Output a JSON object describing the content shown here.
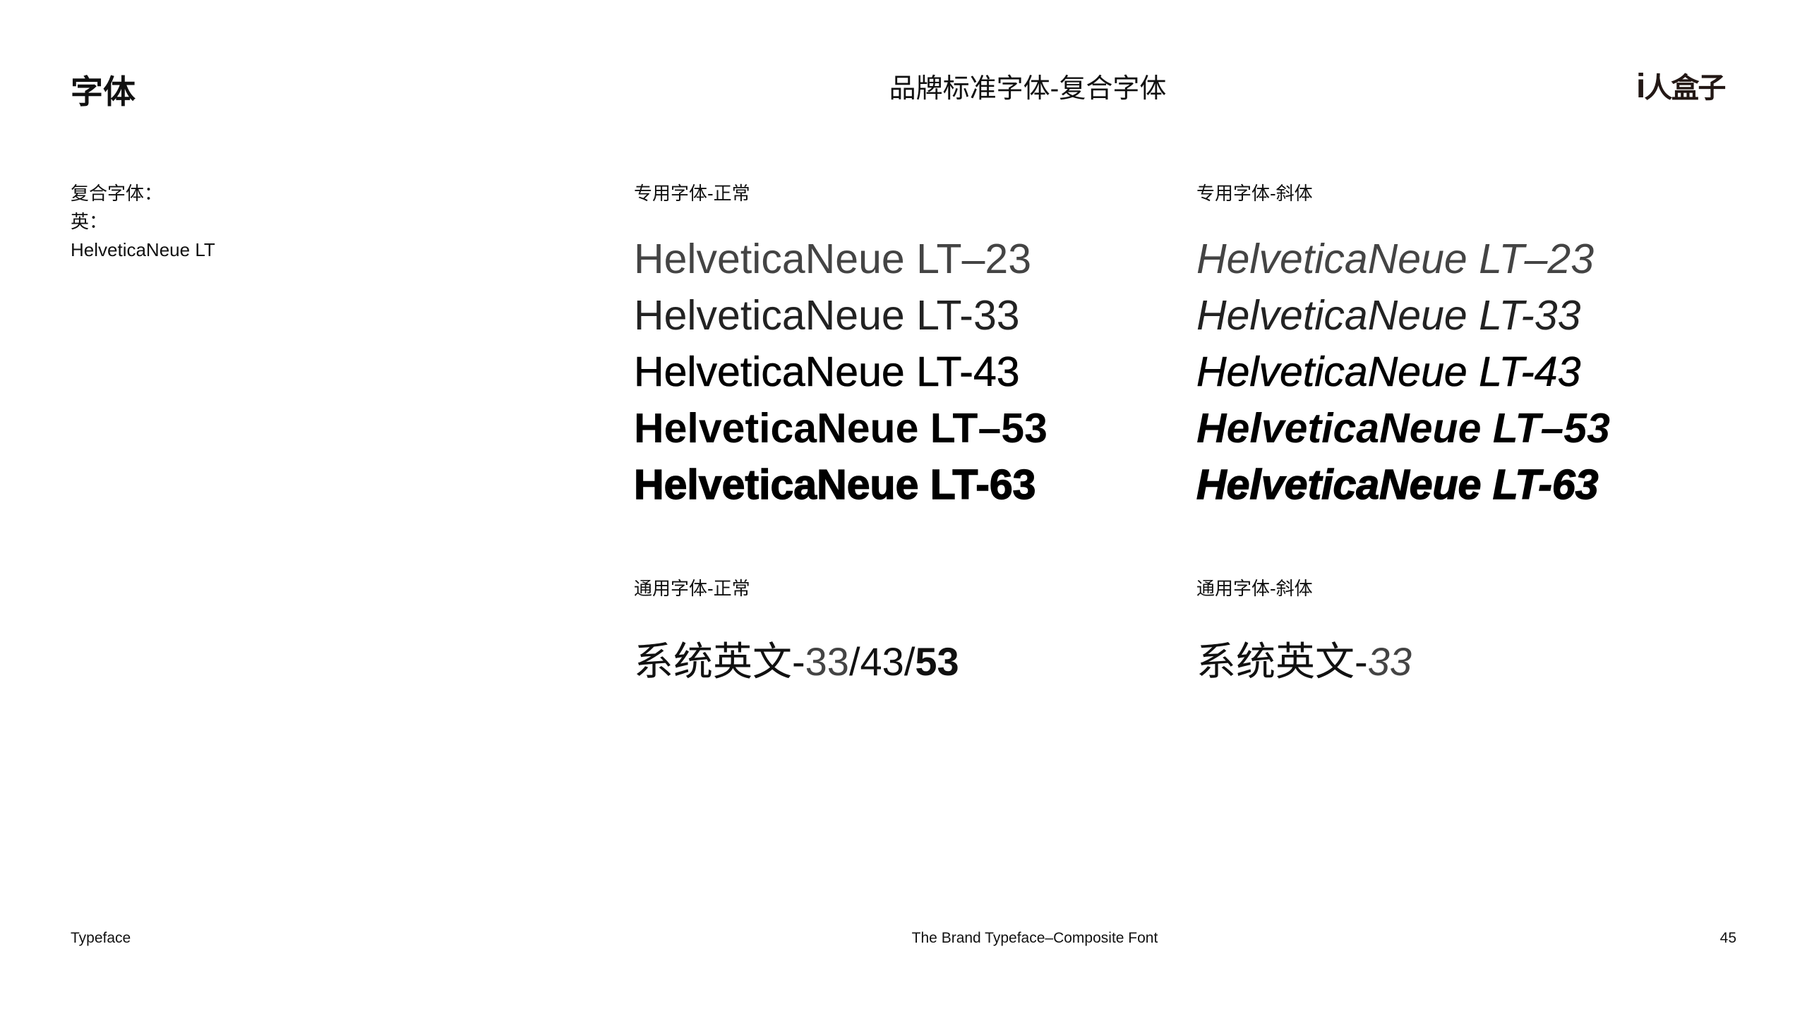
{
  "header": {
    "section": "字体",
    "title": "品牌标准字体-复合字体",
    "logo_text": "i人盒子"
  },
  "left": {
    "lines": [
      "复合字体：",
      "英：",
      "HelveticaNeue LT"
    ]
  },
  "columns": {
    "dedicated_regular": {
      "label": "专用字体-正常",
      "samples": [
        "HelveticaNeue LT–23",
        "HelveticaNeue LT-33",
        "HelveticaNeue LT-43",
        "HelveticaNeue LT–53",
        "HelveticaNeue LT-63"
      ]
    },
    "dedicated_italic": {
      "label": "专用字体-斜体",
      "samples": [
        "HelveticaNeue LT–23",
        "HelveticaNeue LT-33",
        "HelveticaNeue LT-43",
        "HelveticaNeue LT–53",
        "HelveticaNeue LT-63"
      ]
    },
    "general_regular": {
      "label": "通用字体-正常",
      "prefix": "系统英文-",
      "w33": "33",
      "sep1": "/",
      "w43": "43",
      "sep2": "/",
      "w53": "53"
    },
    "general_italic": {
      "label": "通用字体-斜体",
      "prefix": "系统英文-",
      "w33": "33"
    }
  },
  "footer": {
    "left": "Typeface",
    "center": "The Brand Typeface–Composite Font",
    "page": "45"
  }
}
